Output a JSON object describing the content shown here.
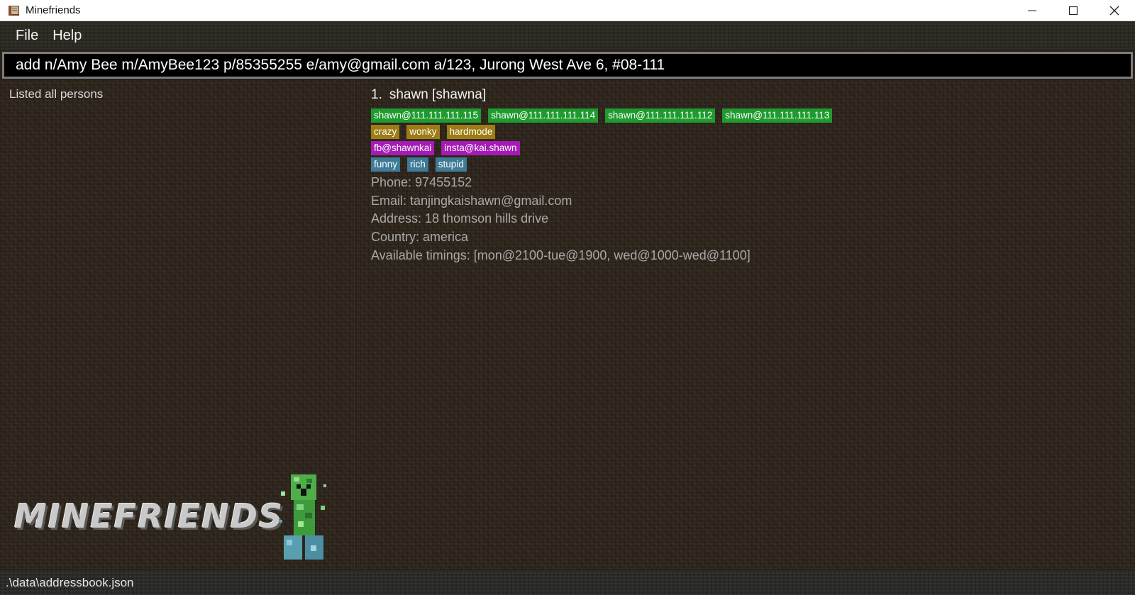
{
  "window": {
    "title": "Minefriends",
    "icon": "book-icon",
    "controls": [
      "minimize-icon",
      "maximize-icon",
      "close-icon"
    ]
  },
  "menu": {
    "file_label": "File",
    "help_label": "Help"
  },
  "command_box": {
    "value": "add n/Amy Bee m/AmyBee123 p/85355255 e/amy@gmail.com a/123, Jurong West Ave 6, #08-111"
  },
  "result_display": {
    "text": "Listed all persons"
  },
  "logo": {
    "text": "MINEFRIENDS",
    "mascot_icon": "creeper-icon"
  },
  "persons": [
    {
      "index": "1.",
      "name": "shawn [shawna]",
      "server_tags": [
        "shawn@111.111.111.115",
        "shawn@111.111.111.114",
        "shawn@111.111.111.112",
        "shawn@111.111.111.113"
      ],
      "game_type_tags": [
        "crazy",
        "wonky",
        "hardmode"
      ],
      "social_tags": [
        "fb@shawnkai",
        "insta@kai.shawn"
      ],
      "tags": [
        "funny",
        "rich",
        "stupid"
      ],
      "phone": "Phone: 97455152",
      "email": "Email: tanjingkaishawn@gmail.com",
      "address": "Address: 18 thomson hills drive",
      "country": "Country: america",
      "timings": "Available timings: [mon@2100-tue@1900, wed@1000-wed@1100]"
    }
  ],
  "status_bar": {
    "path": ".\\data\\addressbook.json"
  },
  "colors": {
    "server_tag": "#1e9a2e",
    "game_type_tag": "#9e7c14",
    "social_tag": "#a61bb5",
    "tag": "#3f7a96",
    "background": "#2d241b"
  }
}
